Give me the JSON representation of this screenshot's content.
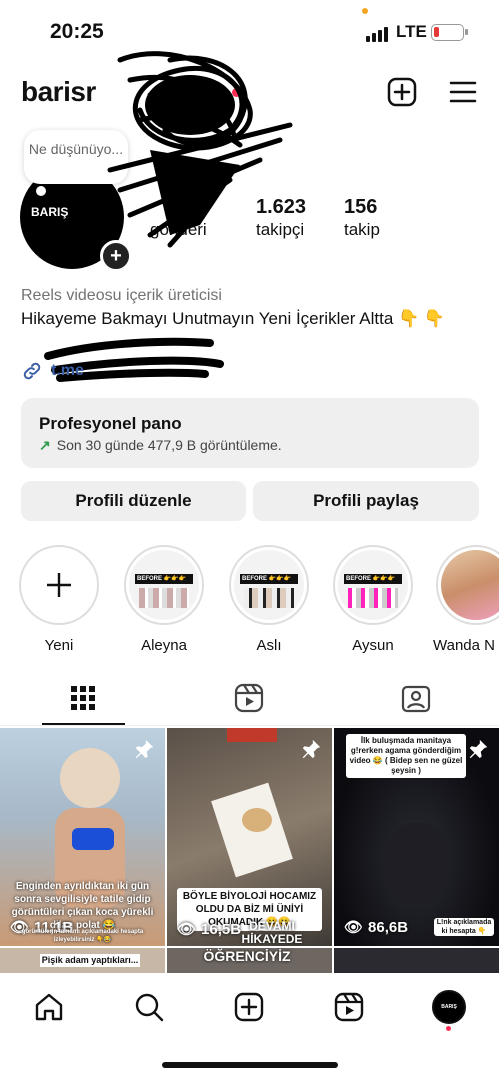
{
  "status_bar": {
    "time": "20:25",
    "network": "LTE"
  },
  "header": {
    "username": "barisr"
  },
  "note": {
    "text": "Ne düşünüyo..."
  },
  "avatar": {
    "label": "BARIŞ"
  },
  "stats": {
    "posts": {
      "value": "",
      "label": "gönderi"
    },
    "followers": {
      "value": "1.623",
      "label": "takipçi"
    },
    "following": {
      "value": "156",
      "label": "takip"
    }
  },
  "bio": {
    "category": "Reels videosu içerik üreticisi",
    "text": "Hikayeme Bakmayı Unutmayın Yeni İçerikler Altta 👇 👇",
    "link": "t.me"
  },
  "pro_panel": {
    "title": "Profesyonel pano",
    "subtitle": "Son 30 günde 477,9 B görüntüleme."
  },
  "buttons": {
    "edit": "Profili düzenle",
    "share": "Profili paylaş"
  },
  "highlights": [
    {
      "label": "Yeni"
    },
    {
      "label": "Aleyna",
      "cover_text": "BEFORE 👉👉👉"
    },
    {
      "label": "Aslı",
      "cover_text": "BEFORE 👉👉👉"
    },
    {
      "label": "Aysun",
      "cover_text": "BEFORE 👉👉👉"
    },
    {
      "label": "Wanda N"
    }
  ],
  "grid": [
    {
      "views": "11,1B",
      "caption": "Enginden ayrıldıktan iki gün sonra sevgilisiyle tatile gidip görüntüleri çıkan koca yürekli dilan polat 😂",
      "footer": "görüntülerin tamamı açıklamadaki hesapta izleyebilirsiniz 👇😂",
      "bg": "#8aa9c4"
    },
    {
      "views": "16,5B",
      "caption": "BÖYLE BİYOLOJİ HOCAMIZ OLDU DA BİZ Mİ ÜNİYİ OKUMADIK 😀😀",
      "footer": "DEVAMI HİKAYEDE",
      "bg": "#6b6256"
    },
    {
      "views": "86,6B",
      "caption": "İlk buluşmada manitaya g!rerken agama gönderdiğim video 😂 ( Bidep sen ne güzel şeysin )",
      "footer": "L!nk açıklamada ki hesapta 👇",
      "bg": "#1b1b22"
    }
  ],
  "grid_row2": [
    {
      "caption": "Pişik adam yaptıkları..."
    },
    {
      "caption": "ÖĞRENCİYİZ"
    },
    {
      "caption": ""
    }
  ],
  "colors": {
    "accent": "#ff2d55",
    "link": "#3b5fa6",
    "panel": "#efefef"
  },
  "icons": [
    "new-post-icon",
    "menu-icon",
    "grid-icon",
    "reels-icon",
    "tagged-icon",
    "home-icon",
    "search-icon",
    "create-icon",
    "reels-nav-icon",
    "profile-avatar-icon"
  ]
}
